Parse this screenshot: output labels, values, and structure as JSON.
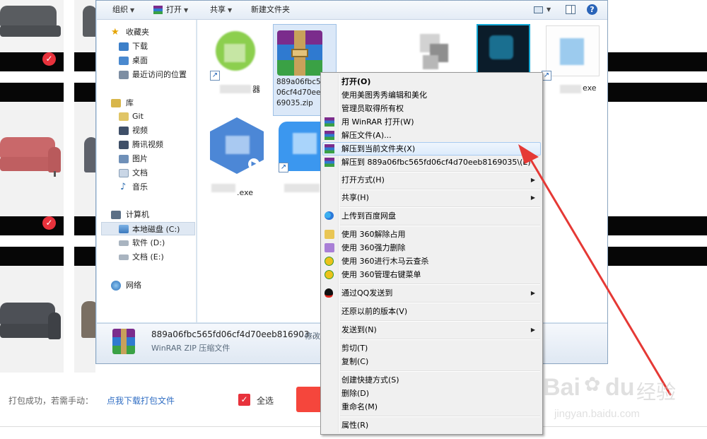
{
  "explorer": {
    "toolbar": {
      "organize": "组织",
      "open": "打开",
      "share": "共享",
      "new_folder": "新建文件夹"
    },
    "nav": {
      "favorites": "收藏夹",
      "downloads": "下载",
      "desktop": "桌面",
      "recent": "最近访问的位置",
      "libraries": "库",
      "git": "Git",
      "videos": "视频",
      "tencent_video": "腾讯视频",
      "pictures": "图片",
      "documents": "文档",
      "music": "音乐",
      "computer": "计算机",
      "drive_c": "本地磁盘 (C:)",
      "drive_d": "软件 (D:)",
      "drive_e": "文档 (E:)",
      "network": "网络"
    },
    "files": [
      {
        "name": "889a06fbc56\n06cf4d70ee\n69035.zip"
      },
      {
        "name": "器"
      },
      {
        "name": "exe"
      },
      {
        "name": ".exe"
      }
    ],
    "details": {
      "file_name": "889a06fbc565fd06cf4d70eeb816903...",
      "modified_label": "修改",
      "file_type": "WinRAR ZIP 压缩文件"
    }
  },
  "context_menu": {
    "items": [
      {
        "label": "打开(O)",
        "bold": true
      },
      {
        "label": "使用美图秀秀编辑和美化"
      },
      {
        "label": "管理员取得所有权"
      },
      {
        "label": "用 WinRAR 打开(W)"
      },
      {
        "label": "解压文件(A)..."
      },
      {
        "label": "解压到当前文件夹(X)"
      },
      {
        "label": "解压到 889a06fbc565fd06cf4d70eeb8169035\\(E)"
      },
      {
        "label": "打开方式(H)"
      },
      {
        "label": "共享(H)"
      },
      {
        "label": "上传到百度网盘"
      },
      {
        "label": "使用 360解除占用"
      },
      {
        "label": "使用 360强力删除"
      },
      {
        "label": "使用 360进行木马云查杀"
      },
      {
        "label": "使用 360管理右键菜单"
      },
      {
        "label": "通过QQ发送到"
      },
      {
        "label": "还原以前的版本(V)"
      },
      {
        "label": "发送到(N)"
      },
      {
        "label": "剪切(T)"
      },
      {
        "label": "复制(C)"
      },
      {
        "label": "创建快捷方式(S)"
      },
      {
        "label": "删除(D)"
      },
      {
        "label": "重命名(M)"
      },
      {
        "label": "属性(R)"
      }
    ],
    "highlighted_index": 5
  },
  "bottom_bar": {
    "message": "打包成功，若需手动：",
    "download_link": "点我下载打包文件",
    "select_all": "全选"
  },
  "watermark": {
    "brand": "Bai",
    "suffix": "du",
    "product": "经验",
    "url": "jingyan.baidu.com"
  },
  "colors": {
    "accent_red": "#e8323c",
    "link_blue": "#2f6dc3",
    "arrow_red": "#e53935",
    "highlight_bg": "#dcebfc"
  }
}
